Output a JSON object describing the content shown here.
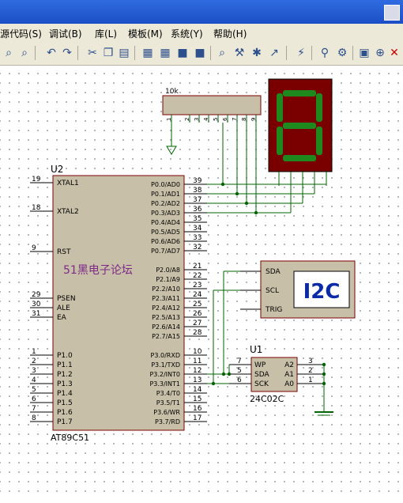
{
  "menu": {
    "items": [
      "源代码(S)",
      "调试(B)",
      "库(L)",
      "模板(M)",
      "系统(Y)",
      "帮助(H)"
    ]
  },
  "toolbar": {
    "icons": [
      "zoom-in-icon",
      "zoom-area-icon",
      "undo-icon",
      "redo-icon",
      "cut-icon",
      "copy-icon",
      "paste-icon",
      "block-copy-icon",
      "block-move-icon",
      "block-rotate-icon",
      "block-delete-icon",
      "pick-device-icon",
      "make-device-icon",
      "packaging-icon",
      "decompose-icon",
      "wire-autorouter-icon",
      "search-tag-icon",
      "property-assign-icon",
      "new-sheet-icon",
      "remove-sheet-icon",
      "bom-icon"
    ]
  },
  "schematic": {
    "resistor_pack": {
      "value": "10k",
      "pins": [
        "1",
        "2",
        "3",
        "4",
        "5",
        "6",
        "7",
        "8",
        "9"
      ]
    },
    "mcu": {
      "ref": "U2",
      "part": "AT89C51",
      "left_pins": [
        {
          "num": "19",
          "name": "XTAL1"
        },
        {
          "num": "18",
          "name": "XTAL2"
        },
        {
          "num": "9",
          "name": "RST"
        },
        {
          "num": "29",
          "name": "PSEN"
        },
        {
          "num": "30",
          "name": "ALE"
        },
        {
          "num": "31",
          "name": "EA"
        },
        {
          "num": "1",
          "name": "P1.0"
        },
        {
          "num": "2",
          "name": "P1.1"
        },
        {
          "num": "3",
          "name": "P1.2"
        },
        {
          "num": "4",
          "name": "P1.3"
        },
        {
          "num": "5",
          "name": "P1.4"
        },
        {
          "num": "6",
          "name": "P1.5"
        },
        {
          "num": "7",
          "name": "P1.6"
        },
        {
          "num": "8",
          "name": "P1.7"
        }
      ],
      "right_pins": [
        {
          "num": "39",
          "name": "P0.0/AD0"
        },
        {
          "num": "38",
          "name": "P0.1/AD1"
        },
        {
          "num": "37",
          "name": "P0.2/AD2"
        },
        {
          "num": "36",
          "name": "P0.3/AD3"
        },
        {
          "num": "35",
          "name": "P0.4/AD4"
        },
        {
          "num": "34",
          "name": "P0.5/AD5"
        },
        {
          "num": "33",
          "name": "P0.6/AD6"
        },
        {
          "num": "32",
          "name": "P0.7/AD7"
        },
        {
          "num": "21",
          "name": "P2.0/A8"
        },
        {
          "num": "22",
          "name": "P2.1/A9"
        },
        {
          "num": "23",
          "name": "P2.2/A10"
        },
        {
          "num": "24",
          "name": "P2.3/A11"
        },
        {
          "num": "25",
          "name": "P2.4/A12"
        },
        {
          "num": "26",
          "name": "P2.5/A13"
        },
        {
          "num": "27",
          "name": "P2.6/A14"
        },
        {
          "num": "28",
          "name": "P2.7/A15"
        },
        {
          "num": "10",
          "name": "P3.0/RXD"
        },
        {
          "num": "11",
          "name": "P3.1/TXD"
        },
        {
          "num": "12",
          "name": "P3.2/INT0"
        },
        {
          "num": "13",
          "name": "P3.3/INT1"
        },
        {
          "num": "14",
          "name": "P3.4/T0"
        },
        {
          "num": "15",
          "name": "P3.5/T1"
        },
        {
          "num": "16",
          "name": "P3.6/WR"
        },
        {
          "num": "17",
          "name": "P3.7/RD"
        }
      ]
    },
    "watermark": "51黑电子论坛",
    "i2c_debugger": {
      "pins": [
        "SDA",
        "SCL",
        "TRIG"
      ],
      "display": "I2C"
    },
    "eeprom": {
      "ref": "U1",
      "part": "24C02C",
      "left_pins": [
        {
          "num": "7",
          "name": "WP"
        },
        {
          "num": "5",
          "name": "SDA"
        },
        {
          "num": "6",
          "name": "SCK"
        }
      ],
      "right_pins": [
        {
          "num": "3",
          "name": "A2"
        },
        {
          "num": "2",
          "name": "A1"
        },
        {
          "num": "1",
          "name": "A0"
        }
      ]
    },
    "seven_seg": {
      "digit": "8"
    }
  },
  "colors": {
    "component_fill": "#c8bfa8",
    "wire": "#006400",
    "seg_bg": "#7a0000",
    "seg_on": "#1e8a1e",
    "i2c_text": "#0a2aa8",
    "watermark": "#7d2a86"
  }
}
